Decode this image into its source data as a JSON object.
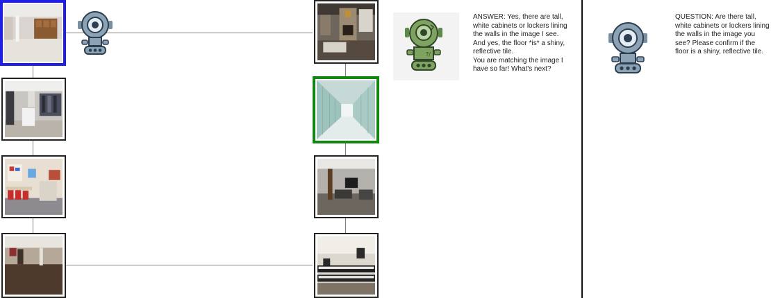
{
  "left_grid": {
    "thumbnails": [
      {
        "id": "basement-empty",
        "scene": "empty basement with wooden cabinets",
        "state": "selected-blue"
      },
      {
        "id": "laundry-room",
        "scene": "room with clothing racks"
      },
      {
        "id": "playroom",
        "scene": "playroom with red chairs"
      },
      {
        "id": "dark-basement",
        "scene": "dark basement with brown floor"
      }
    ]
  },
  "right_grid": {
    "thumbnails": [
      {
        "id": "fireplace-living",
        "scene": "living room with stone fireplace"
      },
      {
        "id": "locker-hallway",
        "scene": "hallway lined with white lockers",
        "state": "selected-green"
      },
      {
        "id": "tv-basement",
        "scene": "basement with tv and couches"
      },
      {
        "id": "music-studio",
        "scene": "room with keyboards and studio gear"
      }
    ]
  },
  "answerer": {
    "avatar_icon": "green-robot-icon",
    "answer_text": "ANSWER: Yes, there are tall, white cabinets or lockers lining the walls in the image I see. And yes, the floor *is* a shiny, reflective tile.",
    "follow_text": "You are matching the image I have so far! What's next?"
  },
  "questioner": {
    "avatar_icon": "blue-robot-icon",
    "question_text": "QUESTION: Are there tall, white cabinets or lockers lining the walls in the image you see? Please confirm if the floor is a shiny, reflective tile."
  },
  "colors": {
    "blue_selection": "#1f1fe6",
    "green_selection": "#128512",
    "connector": "#7f7f7f",
    "divider": "#111111",
    "bubble_bg": "#f3f3f3"
  }
}
